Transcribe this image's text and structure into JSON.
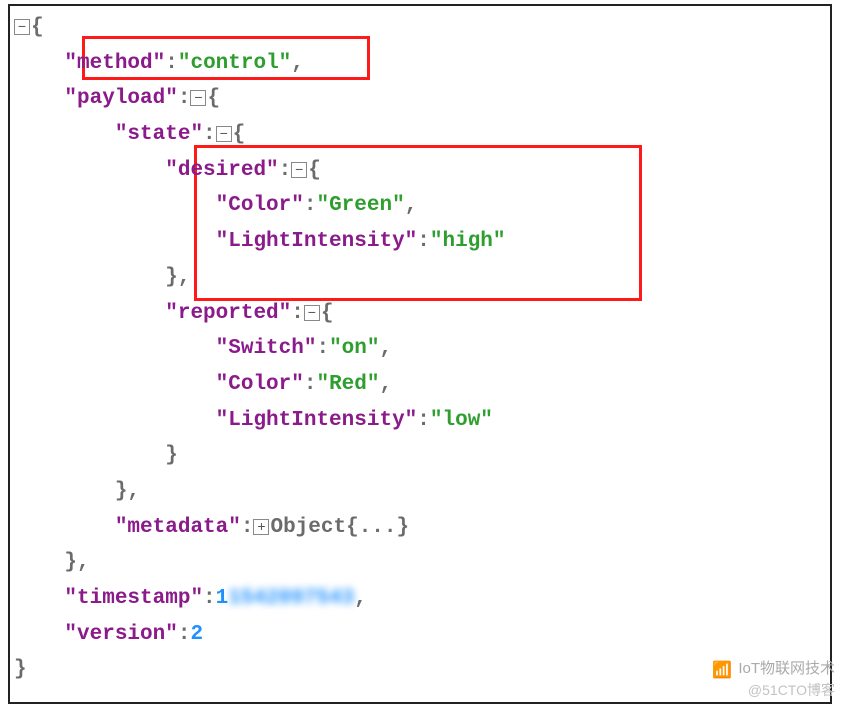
{
  "root": {
    "method_key": "\"method\"",
    "method_val": "\"control\"",
    "payload_key": "\"payload\"",
    "state_key": "\"state\"",
    "desired_key": "\"desired\"",
    "color_key": "\"Color\"",
    "green_val": "\"Green\"",
    "li_key": "\"LightIntensity\"",
    "high_val": "\"high\"",
    "reported_key": "\"reported\"",
    "switch_key": "\"Switch\"",
    "on_val": "\"on\"",
    "red_val": "\"Red\"",
    "low_val": "\"low\"",
    "metadata_key": "\"metadata\"",
    "object_lbl": "Object",
    "ellipsis": "{...}",
    "timestamp_key": "\"timestamp\"",
    "timestamp_val": "1542097543",
    "version_key": "\"version\"",
    "version_val": "2"
  },
  "watermark": {
    "title": "IoT物联网技术",
    "sub": "@51CTO博客"
  }
}
